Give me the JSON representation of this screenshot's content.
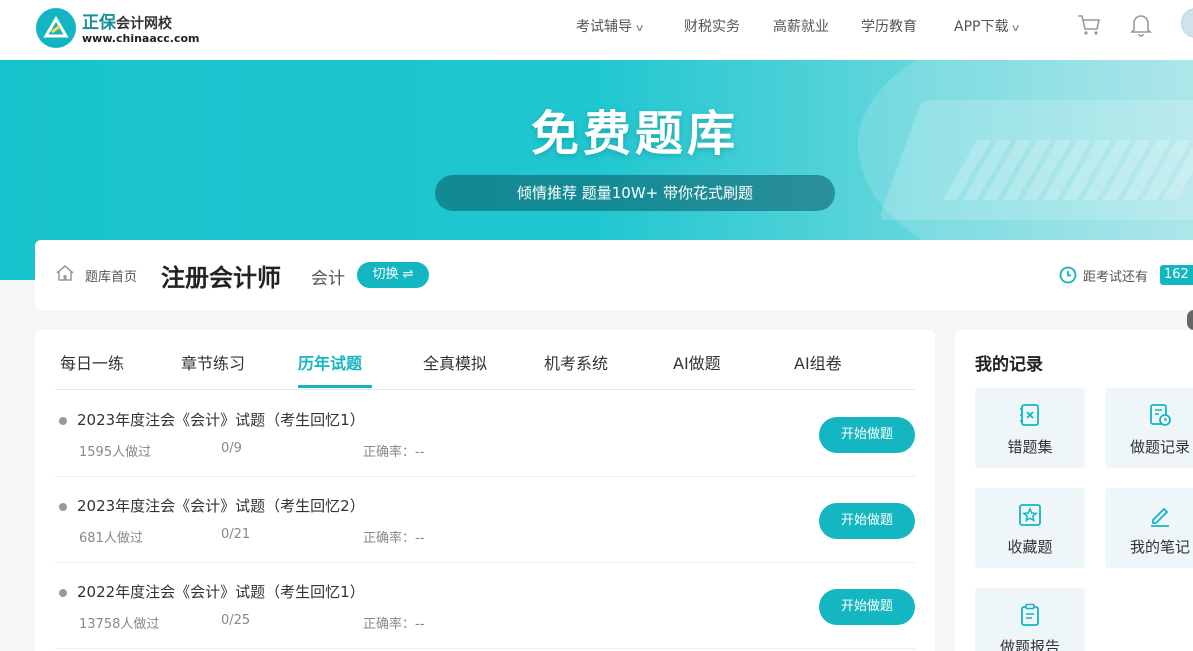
{
  "header": {
    "logo_title": "正保",
    "logo_subtitle": "会计网校",
    "logo_url": "www.chinaacc.com",
    "nav": [
      {
        "label": "考试辅导",
        "has_dropdown": true
      },
      {
        "label": "财税实务",
        "has_dropdown": false
      },
      {
        "label": "高薪就业",
        "has_dropdown": false
      },
      {
        "label": "学历教育",
        "has_dropdown": false
      },
      {
        "label": "APP下载",
        "has_dropdown": true
      }
    ],
    "icons": [
      "cart-icon",
      "bell-icon",
      "avatar"
    ]
  },
  "banner": {
    "title": "免费题库",
    "slogan": "倾情推荐 题量10W+ 带你花式刷题"
  },
  "subject": {
    "home_label": "题库首页",
    "title": "注册会计师",
    "subject_name": "会计",
    "switch_label": "切换 ⇌",
    "countdown_label": "距考试还有",
    "countdown_days": "162"
  },
  "tabs": [
    {
      "label": "每日一练",
      "active": false
    },
    {
      "label": "章节练习",
      "active": false
    },
    {
      "label": "历年试题",
      "active": true
    },
    {
      "label": "全真模拟",
      "active": false
    },
    {
      "label": "机考系统",
      "active": false
    },
    {
      "label": "AI做题",
      "active": false
    },
    {
      "label": "AI组卷",
      "active": false
    }
  ],
  "papers": [
    {
      "title": "2023年度注会《会计》试题（考生回忆1）",
      "count": "1595人做过",
      "progress": "0/9",
      "accuracy": "正确率：--",
      "button": "开始做题"
    },
    {
      "title": "2023年度注会《会计》试题（考生回忆2）",
      "count": "681人做过",
      "progress": "0/21",
      "accuracy": "正确率：--",
      "button": "开始做题"
    },
    {
      "title": "2022年度注会《会计》试题（考生回忆1）",
      "count": "13758人做过",
      "progress": "0/25",
      "accuracy": "正确率：--",
      "button": "开始做题"
    }
  ],
  "records": {
    "title": "我的记录",
    "items": [
      {
        "label": "错题集",
        "icon": "wrong-book-icon"
      },
      {
        "label": "做题记录",
        "icon": "history-icon"
      },
      {
        "label": "收藏题",
        "icon": "star-icon"
      },
      {
        "label": "我的笔记",
        "icon": "pencil-icon"
      },
      {
        "label": "做题报告",
        "icon": "report-icon"
      }
    ]
  },
  "colors": {
    "accent": "#13b6c1",
    "banner": "#20c7d0"
  }
}
